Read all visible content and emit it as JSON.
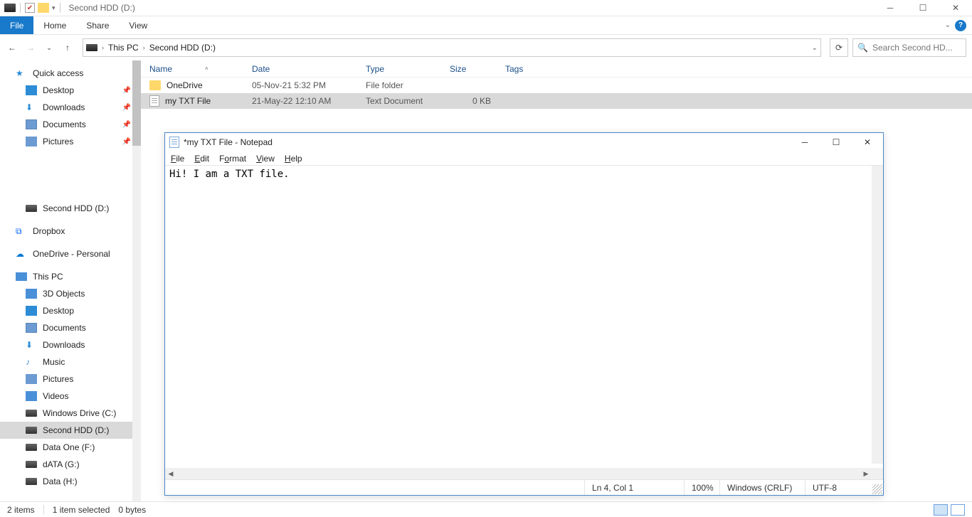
{
  "explorer": {
    "title": "Second HDD (D:)",
    "ribbon": {
      "file": "File",
      "home": "Home",
      "share": "Share",
      "view": "View"
    },
    "breadcrumb": [
      "This PC",
      "Second HDD (D:)"
    ],
    "search_placeholder": "Search Second HD...",
    "cols": {
      "name": "Name",
      "date": "Date",
      "type": "Type",
      "size": "Size",
      "tags": "Tags"
    },
    "rows": [
      {
        "name": "OneDrive",
        "date": "05-Nov-21 5:32 PM",
        "type": "File folder",
        "size": ""
      },
      {
        "name": "my TXT File",
        "date": "21-May-22 12:10 AM",
        "type": "Text Document",
        "size": "0 KB"
      }
    ],
    "sidebar": {
      "quick": "Quick access",
      "quick_items": [
        "Desktop",
        "Downloads",
        "Documents",
        "Pictures"
      ],
      "hdd": "Second HDD (D:)",
      "dropbox": "Dropbox",
      "onedrive": "OneDrive - Personal",
      "thispc": "This PC",
      "pc_items": [
        "3D Objects",
        "Desktop",
        "Documents",
        "Downloads",
        "Music",
        "Pictures",
        "Videos",
        "Windows Drive (C:)",
        "Second HDD (D:)",
        "Data One (F:)",
        "dATA (G:)",
        "Data (H:)"
      ]
    },
    "status": {
      "count": "2 items",
      "sel": "1 item selected",
      "bytes": "0 bytes"
    }
  },
  "notepad": {
    "title": "*my TXT File - Notepad",
    "menus": {
      "file": "File",
      "edit": "Edit",
      "format": "Format",
      "view": "View",
      "help": "Help"
    },
    "content": "Hi! I am a TXT file.",
    "status": {
      "pos": "Ln 4, Col 1",
      "zoom": "100%",
      "eol": "Windows (CRLF)",
      "enc": "UTF-8"
    }
  }
}
